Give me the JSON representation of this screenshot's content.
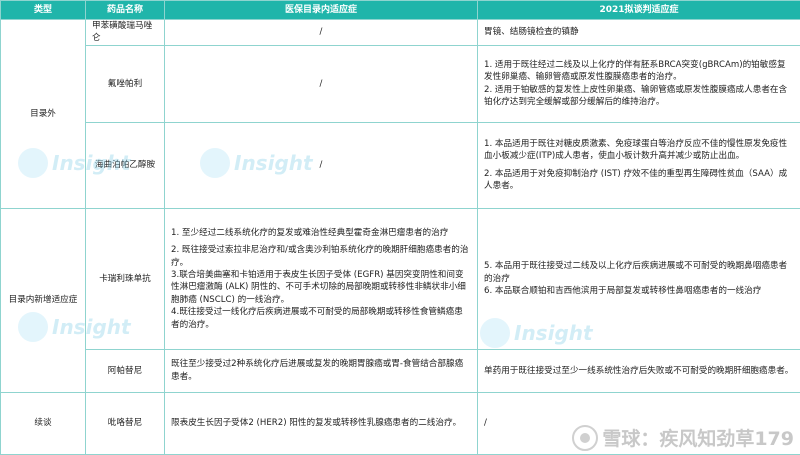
{
  "headers": {
    "type": "类型",
    "drug": "药品名称",
    "covered": "医保目录内适应症",
    "proposed": "2021拟谈判适应症"
  },
  "groups": {
    "outside": "目录外",
    "new_ind": "目录内新增适应症",
    "renewal": "续谈"
  },
  "rows": [
    {
      "drug": "甲苯磺酸瑞马唑仑",
      "covered": "/",
      "proposed": [
        "胃镜、结肠镜检查的镇静"
      ]
    },
    {
      "drug": "氟唑帕利",
      "covered": "/",
      "proposed": [
        "1. 适用于既往经过二线及以上化疗的伴有胚系BRCA突变(gBRCAm)的铂敏感复发性卵巢癌、输卵管癌或原发性腹膜癌患者的治疗。",
        "2. 适用于铂敏感的复发性上皮性卵巢癌、输卵管癌或原发性腹膜癌成人患者在含铂化疗达到完全缓解或部分缓解后的维持治疗。"
      ]
    },
    {
      "drug": "海曲泊帕乙醇胺",
      "covered": "/",
      "proposed": [
        "1. 本品适用于既往对糖皮质激素、免疫球蛋白等治疗反应不佳的慢性原发免疫性血小板减少症(ITP)成人患者，使血小板计数升高并减少或防止出血。",
        "2. 本品适用于对免疫抑制治疗 (IST) 疗效不佳的重型再生障碍性贫血（SAA）成人患者。"
      ]
    },
    {
      "drug": "卡瑞利珠单抗",
      "covered": [
        "1. 至少经过二线系统化疗的复发或难治性经典型霍奇金淋巴瘤患者的治疗",
        "2. 既往接受过索拉非尼治疗和/或含奥沙利铂系统化疗的晚期肝细胞癌患者的治疗。",
        "3.联合培美曲塞和卡铂适用于表皮生长因子受体 (EGFR) 基因突变阴性和间变性淋巴瘤激酶 (ALK) 阴性的、不可手术切除的局部晚期或转移性非鳞状非小细胞肺癌 (NSCLC) 的一线治疗。",
        "4.既往接受过一线化疗后疾病进展或不可耐受的局部晚期或转移性食管鳞癌患者的治疗。"
      ],
      "proposed": [
        "5. 本品用于既往接受过二线及以上化疗后疾病进展或不可耐受的晚期鼻咽癌患者的治疗",
        "6. 本品联合顺铂和吉西他滨用于局部复发或转移性鼻咽癌患者的一线治疗"
      ]
    },
    {
      "drug": "阿帕替尼",
      "covered": [
        "既往至少接受过2种系统化疗后进展或复发的晚期胃腺癌或胃-食管结合部腺癌患者。"
      ],
      "proposed": [
        "单药用于既往接受过至少一线系统性治疗后失败或不可耐受的晚期肝细胞癌患者。"
      ]
    },
    {
      "drug": "吡咯替尼",
      "covered": [
        "限表皮生长因子受体2 (HER2) 阳性的复发或转移性乳腺癌患者的二线治疗。"
      ],
      "proposed": [
        "/"
      ]
    }
  ],
  "watermark": "Insight",
  "footer_watermark": "雪球：疾风知劲草179"
}
